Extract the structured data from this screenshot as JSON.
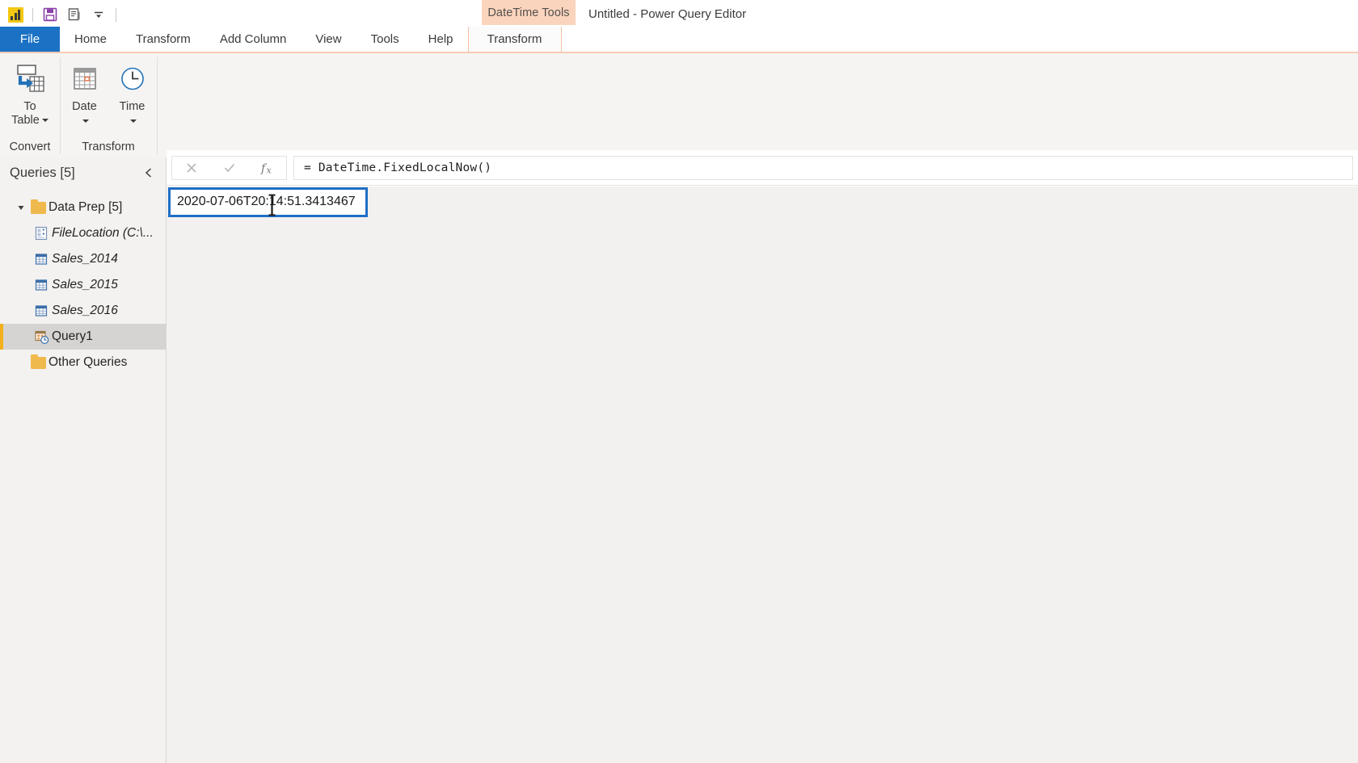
{
  "window": {
    "title": "Untitled - Power Query Editor",
    "contextual_group": "DateTime Tools"
  },
  "quick_access": {
    "items": [
      {
        "name": "power-bi-logo",
        "label": "Power BI"
      },
      {
        "name": "save-icon",
        "label": "Save"
      },
      {
        "name": "properties-icon",
        "label": "Properties"
      },
      {
        "name": "customize-qat-icon",
        "label": "Customize Quick Access Toolbar"
      }
    ]
  },
  "ribbon": {
    "tabs": [
      {
        "label": "File",
        "state": "file"
      },
      {
        "label": "Home",
        "state": "normal"
      },
      {
        "label": "Transform",
        "state": "normal"
      },
      {
        "label": "Add Column",
        "state": "normal"
      },
      {
        "label": "View",
        "state": "normal"
      },
      {
        "label": "Tools",
        "state": "normal"
      },
      {
        "label": "Help",
        "state": "normal"
      },
      {
        "label": "Transform",
        "state": "contextual-active"
      }
    ],
    "groups": [
      {
        "label": "Convert",
        "buttons": [
          {
            "label_line1": "To",
            "label_line2": "Table",
            "icon": "to-table-icon",
            "has_caret": true
          }
        ]
      },
      {
        "label": "Transform",
        "buttons": [
          {
            "label_line1": "Date",
            "label_line2": "",
            "icon": "calendar-icon",
            "has_caret": true
          },
          {
            "label_line1": "Time",
            "label_line2": "",
            "icon": "clock-icon",
            "has_caret": true
          }
        ]
      }
    ]
  },
  "queries_pane": {
    "title": "Queries [5]",
    "collapse_icon": "chevron-left-icon",
    "items": [
      {
        "label": "Data Prep [5]",
        "icon": "folder-icon",
        "type": "folder",
        "expanded": true,
        "indent": 0,
        "italic": false,
        "selected": false
      },
      {
        "label": "FileLocation (C:\\...",
        "icon": "parameter-icon",
        "type": "query",
        "indent": 1,
        "italic": true,
        "selected": false
      },
      {
        "label": "Sales_2014",
        "icon": "table-icon",
        "type": "query",
        "indent": 1,
        "italic": true,
        "selected": false
      },
      {
        "label": "Sales_2015",
        "icon": "table-icon",
        "type": "query",
        "indent": 1,
        "italic": true,
        "selected": false
      },
      {
        "label": "Sales_2016",
        "icon": "table-icon",
        "type": "query",
        "indent": 1,
        "italic": true,
        "selected": false
      },
      {
        "label": "Query1",
        "icon": "datetime-icon",
        "type": "query",
        "indent": 1,
        "italic": false,
        "selected": true
      },
      {
        "label": "Other Queries",
        "icon": "folder-icon",
        "type": "folder",
        "expanded": false,
        "indent": 0,
        "italic": false,
        "selected": false
      }
    ]
  },
  "formula_bar": {
    "cancel_icon": "close-icon",
    "commit_icon": "checkmark-icon",
    "fx_icon": "fx-icon",
    "formula": "= DateTime.FixedLocalNow()"
  },
  "result": {
    "value": "2020-07-06T20:14:51.3413467",
    "highlight_color": "#1f6fc4"
  },
  "colors": {
    "file_tab": "#1b72c4",
    "contextual_group": "#fbd4bd",
    "contextual_border": "#f5c1a3",
    "ribbon_bg": "#f5f4f3",
    "pane_bg": "#f3f2f1",
    "canvas_bg": "#f2f1f0",
    "selection_accent": "#f2b01c"
  }
}
